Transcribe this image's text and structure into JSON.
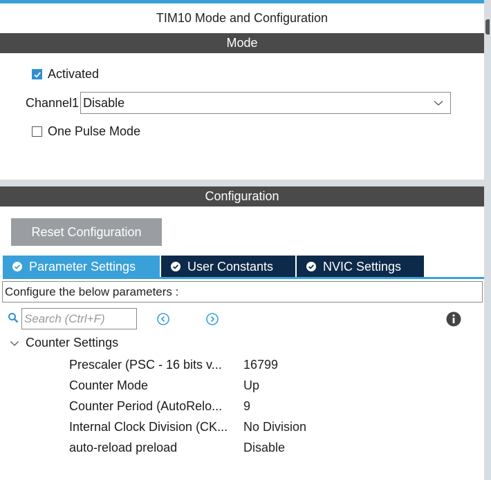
{
  "window": {
    "title": "TIM10 Mode and Configuration"
  },
  "mode": {
    "header": "Mode",
    "activated": {
      "label": "Activated",
      "checked": true
    },
    "channel1": {
      "label": "Channel1",
      "value": "Disable"
    },
    "one_pulse": {
      "label": "One Pulse Mode",
      "checked": false
    }
  },
  "configuration": {
    "header": "Configuration",
    "reset_button": "Reset Configuration",
    "tabs": [
      {
        "label": "Parameter Settings",
        "active": true
      },
      {
        "label": "User Constants",
        "active": false
      },
      {
        "label": "NVIC Settings",
        "active": false
      }
    ],
    "description": "Configure the below parameters :",
    "search": {
      "placeholder": "Search (Ctrl+F)"
    },
    "group": {
      "label": "Counter Settings",
      "params": [
        {
          "name": "Prescaler (PSC - 16 bits v...",
          "value": "16799"
        },
        {
          "name": "Counter Mode",
          "value": "Up"
        },
        {
          "name": "Counter Period (AutoRelo...",
          "value": "9"
        },
        {
          "name": "Internal Clock Division (CK...",
          "value": "No Division"
        },
        {
          "name": "auto-reload preload",
          "value": "Disable"
        }
      ]
    }
  },
  "colors": {
    "accent": "#3aa0d8",
    "tab_inactive": "#0d2a4a",
    "header_bg": "#4a4a4a",
    "button_bg": "#9a9ea2"
  }
}
